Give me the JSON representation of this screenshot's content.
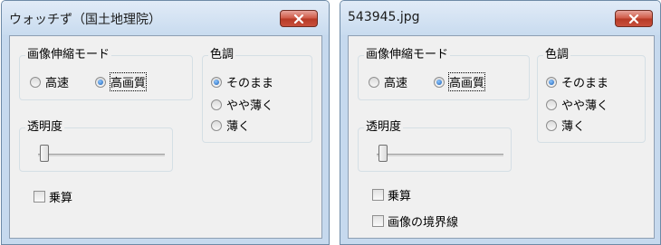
{
  "windows": [
    {
      "title": "ウォッチず（国土地理院）",
      "close_icon": "close-x-icon",
      "scale_group": {
        "label": "画像伸縮モード",
        "options": [
          "高速",
          "高画質"
        ],
        "selected": "高画質"
      },
      "tone_group": {
        "label": "色調",
        "options": [
          "そのまま",
          "やや薄く",
          "薄く"
        ],
        "selected": "そのまま"
      },
      "opacity_group": {
        "label": "透明度",
        "value_fraction": 0.0
      },
      "multiply": {
        "label": "乗算",
        "checked": false
      }
    },
    {
      "title": "543945.jpg",
      "close_icon": "close-x-icon",
      "scale_group": {
        "label": "画像伸縮モード",
        "options": [
          "高速",
          "高画質"
        ],
        "selected": "高画質"
      },
      "tone_group": {
        "label": "色調",
        "options": [
          "そのまま",
          "やや薄く",
          "薄く"
        ],
        "selected": "そのまま"
      },
      "opacity_group": {
        "label": "透明度",
        "value_fraction": 0.0
      },
      "multiply": {
        "label": "乗算",
        "checked": false
      },
      "image_border": {
        "label": "画像の境界線",
        "checked": false
      }
    }
  ],
  "colors": {
    "frame": "#c6d9ee",
    "client": "#f0f0f0",
    "close_button": "#c8503c"
  }
}
